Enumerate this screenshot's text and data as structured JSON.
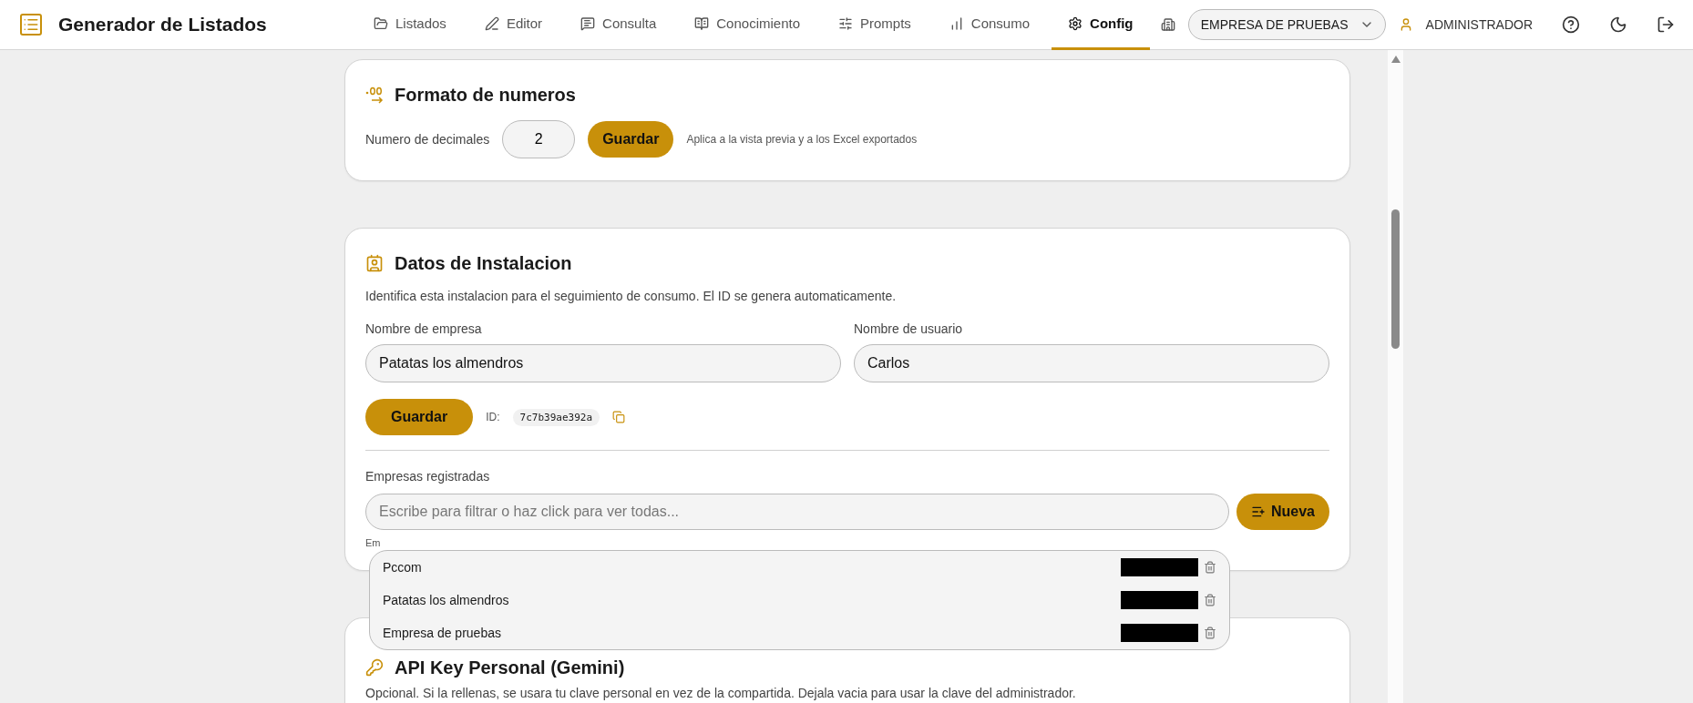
{
  "app": {
    "title": "Generador de Listados"
  },
  "nav": [
    {
      "label": "Listados",
      "selected": false
    },
    {
      "label": "Editor",
      "selected": false
    },
    {
      "label": "Consulta",
      "selected": false
    },
    {
      "label": "Conocimiento",
      "selected": false
    },
    {
      "label": "Prompts",
      "selected": false
    },
    {
      "label": "Consumo",
      "selected": false
    },
    {
      "label": "Config",
      "selected": true
    }
  ],
  "company_select": {
    "value": "EMPRESA DE PRUEBAS"
  },
  "user": {
    "role": "ADMINISTRADOR"
  },
  "number_format": {
    "title": "Formato de numeros",
    "label": "Numero de decimales",
    "value": "2",
    "button": "Guardar",
    "note": "Aplica a la vista previa y a los Excel exportados"
  },
  "installation": {
    "title": "Datos de Instalacion",
    "description": "Identifica esta instalacion para el seguimiento de consumo. El ID se genera automaticamente.",
    "fields": [
      {
        "label": "Nombre de empresa",
        "value": "Patatas los almendros"
      },
      {
        "label": "Nombre de usuario",
        "value": "Carlos"
      }
    ],
    "button": "Guardar",
    "id_label": "ID:",
    "id_value": "7c7b39ae392a",
    "companies_label": "Empresas registradas",
    "search": {
      "placeholder": "Escribe para filtrar o haz click para ver todas..."
    },
    "new_button": "Nueva",
    "hint": "Em",
    "dropdown": [
      {
        "name": "Pccom"
      },
      {
        "name": "Patatas los almendros"
      },
      {
        "name": "Empresa de pruebas"
      }
    ]
  },
  "api_key": {
    "title": "API Key Personal (Gemini)",
    "description": "Opcional. Si la rellenas, se usara tu clave personal en vez de la compartida. Dejala vacia para usar la clave del administrador."
  }
}
